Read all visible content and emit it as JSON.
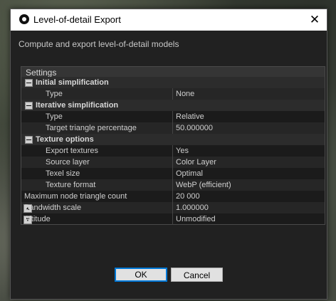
{
  "window": {
    "title": "Level-of-detail Export",
    "close_glyph": "✕"
  },
  "subtitle": "Compute and export level-of-detail models",
  "settings": {
    "header": "Settings",
    "groups": [
      {
        "label": "Initial simplification",
        "rows": [
          {
            "key": "Type",
            "value": "None"
          }
        ]
      },
      {
        "label": "Iterative simplification",
        "rows": [
          {
            "key": "Type",
            "value": "Relative"
          },
          {
            "key": "Target triangle percentage",
            "value": "50.000000"
          }
        ]
      },
      {
        "label": "Texture options",
        "rows": [
          {
            "key": "Export textures",
            "value": "Yes"
          },
          {
            "key": "Source layer",
            "value": "Color Layer"
          },
          {
            "key": "Texel size",
            "value": "Optimal"
          },
          {
            "key": "Texture format",
            "value": "WebP (efficient)"
          }
        ]
      }
    ],
    "top_rows": [
      {
        "key": "Maximum node triangle count",
        "value": "20 000"
      },
      {
        "key": "Bandwidth scale",
        "value": "1.000000"
      },
      {
        "key": "Altitude",
        "value": "Unmodified"
      }
    ]
  },
  "buttons": {
    "ok": "OK",
    "cancel": "Cancel"
  },
  "icons": {
    "app": "app-logo-icon",
    "close": "close-icon",
    "expander": "collapse-minus-icon",
    "scroll_up": "scroll-up-icon",
    "scroll_down": "scroll-down-icon"
  },
  "colors": {
    "dialog_bg": "#212121",
    "titlebar_bg": "#ffffff",
    "ok_focus_border": "#0078d7"
  }
}
